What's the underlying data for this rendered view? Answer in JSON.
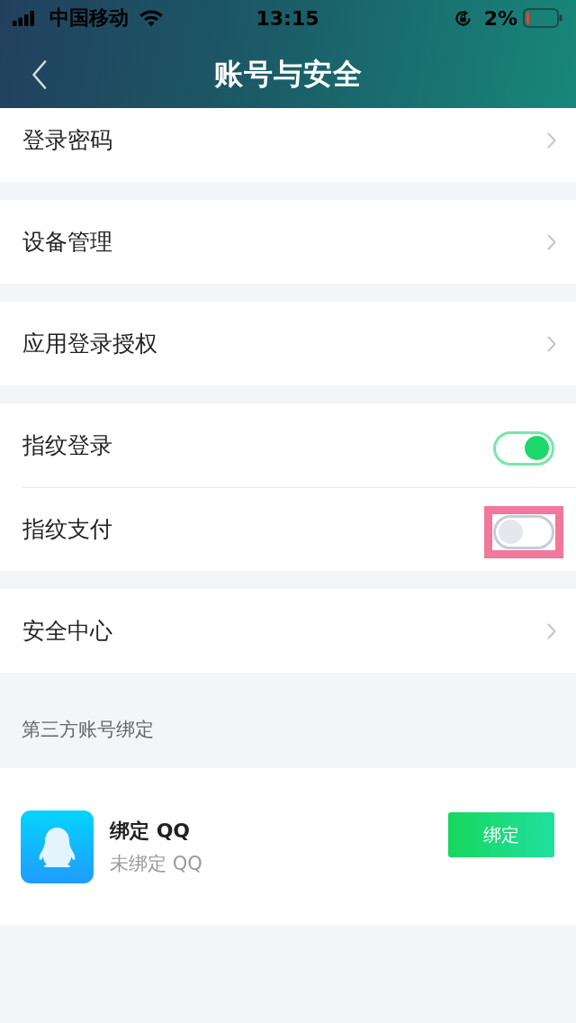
{
  "status_bar": {
    "carrier": "中国移动",
    "time": "13:15",
    "battery": "2%"
  },
  "nav_bar": {
    "title": "账号与安全"
  },
  "groups": [
    {
      "items": [
        {
          "kind": "link",
          "label": "登录密码"
        }
      ]
    },
    {
      "items": [
        {
          "kind": "link",
          "label": "设备管理"
        }
      ]
    },
    {
      "items": [
        {
          "kind": "link",
          "label": "应用登录授权"
        }
      ]
    },
    {
      "items": [
        {
          "kind": "toggle",
          "label": "指纹登录",
          "on": true,
          "highlighted": false
        },
        {
          "kind": "toggle",
          "label": "指纹支付",
          "on": false,
          "highlighted": true
        }
      ]
    },
    {
      "items": [
        {
          "kind": "link",
          "label": "安全中心"
        }
      ]
    }
  ],
  "third_party": {
    "heading": "第三方账号绑定",
    "accounts": [
      {
        "title": "绑定 QQ",
        "subtitle": "未绑定 QQ",
        "button": "绑定"
      }
    ]
  }
}
